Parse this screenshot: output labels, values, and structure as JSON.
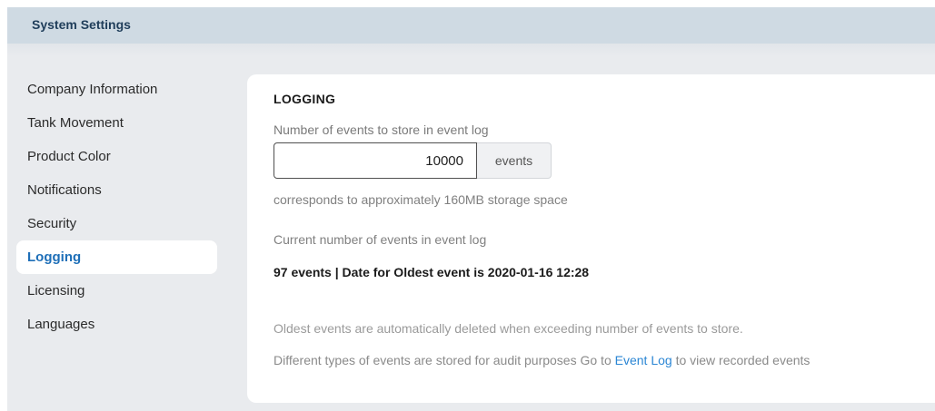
{
  "header": {
    "title": "System Settings"
  },
  "sidebar": {
    "items": [
      {
        "label": "Company Information"
      },
      {
        "label": "Tank Movement"
      },
      {
        "label": "Product Color"
      },
      {
        "label": "Notifications"
      },
      {
        "label": "Security"
      },
      {
        "label": "Logging",
        "active": true
      },
      {
        "label": "Licensing"
      },
      {
        "label": "Languages"
      }
    ]
  },
  "logging": {
    "section_title": "LOGGING",
    "events_to_store_label": "Number of events to store in event log",
    "events_to_store_value": "10000",
    "events_unit": "events",
    "storage_hint": "corresponds to approximately 160MB storage space",
    "current_label": "Current number of events in event log",
    "current_value": "97 events | Date for Oldest event is 2020-01-16 12:28",
    "note_auto_delete": "Oldest events are automatically deleted when exceeding number of events to store.",
    "note_audit_prefix": "Different types of events are stored for audit purposes Go to",
    "note_audit_link": "Event Log",
    "note_audit_suffix": "to view recorded events"
  },
  "colors": {
    "header_bg": "#cfdae3",
    "header_text": "#1f3d5a",
    "active_item": "#1e6fb8",
    "link": "#2b86d4",
    "page_bg": "#e9ebee"
  }
}
